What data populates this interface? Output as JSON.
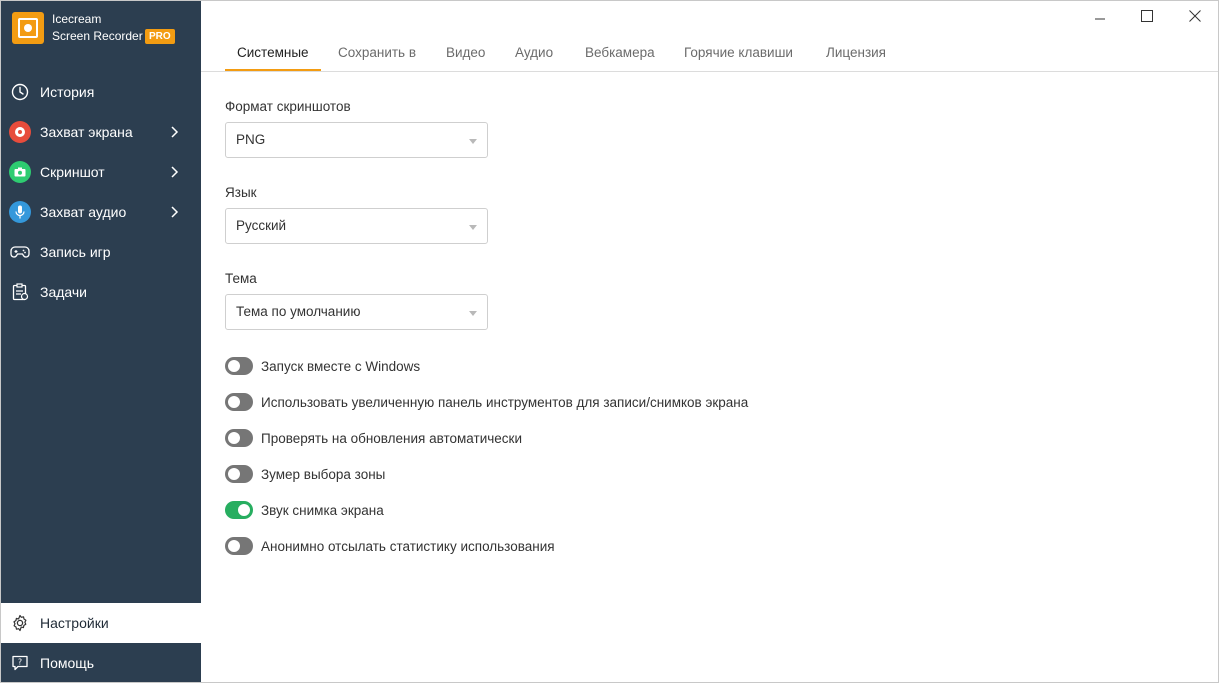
{
  "app": {
    "name_line1": "Icecream",
    "name_line2": "Screen Recorder",
    "badge": "PRO",
    "accent_color": "#f39c12",
    "sidebar_color": "#2c3e50"
  },
  "sidebar": {
    "items": [
      {
        "label": "История",
        "icon": "clock-icon"
      },
      {
        "label": "Захват экрана",
        "icon": "record-icon",
        "icon_color": "#e74c3c"
      },
      {
        "label": "Скриншот",
        "icon": "camera-icon",
        "icon_color": "#2ecc71"
      },
      {
        "label": "Захват аудио",
        "icon": "microphone-icon",
        "icon_color": "#3498db"
      },
      {
        "label": "Запись игр",
        "icon": "gamepad-icon"
      },
      {
        "label": "Задачи",
        "icon": "tasks-icon"
      }
    ],
    "bottom": [
      {
        "label": "Настройки",
        "icon": "gear-icon",
        "active": true
      },
      {
        "label": "Помощь",
        "icon": "help-icon"
      }
    ]
  },
  "window": {
    "minimize": "minimize-icon",
    "maximize": "maximize-icon",
    "close": "close-icon"
  },
  "tabs": [
    {
      "label": "Системные",
      "active": true
    },
    {
      "label": "Сохранить в"
    },
    {
      "label": "Видео"
    },
    {
      "label": "Аудио"
    },
    {
      "label": "Вебкамера"
    },
    {
      "label": "Горячие клавиши"
    },
    {
      "label": "Лицензия"
    }
  ],
  "settings": {
    "screenshot_format": {
      "label": "Формат скриншотов",
      "value": "PNG"
    },
    "language": {
      "label": "Язык",
      "value": "Русский"
    },
    "theme": {
      "label": "Тема",
      "value": "Тема по умолчанию"
    },
    "toggles": [
      {
        "label": "Запуск вместе с Windows",
        "on": false
      },
      {
        "label": "Использовать увеличенную панель инструментов для записи/снимков экрана",
        "on": false
      },
      {
        "label": "Проверять на обновления автоматически",
        "on": false
      },
      {
        "label": "Зумер выбора зоны",
        "on": false
      },
      {
        "label": "Звук снимка экрана",
        "on": true
      },
      {
        "label": "Анонимно отсылать статистику использования",
        "on": false
      }
    ]
  }
}
